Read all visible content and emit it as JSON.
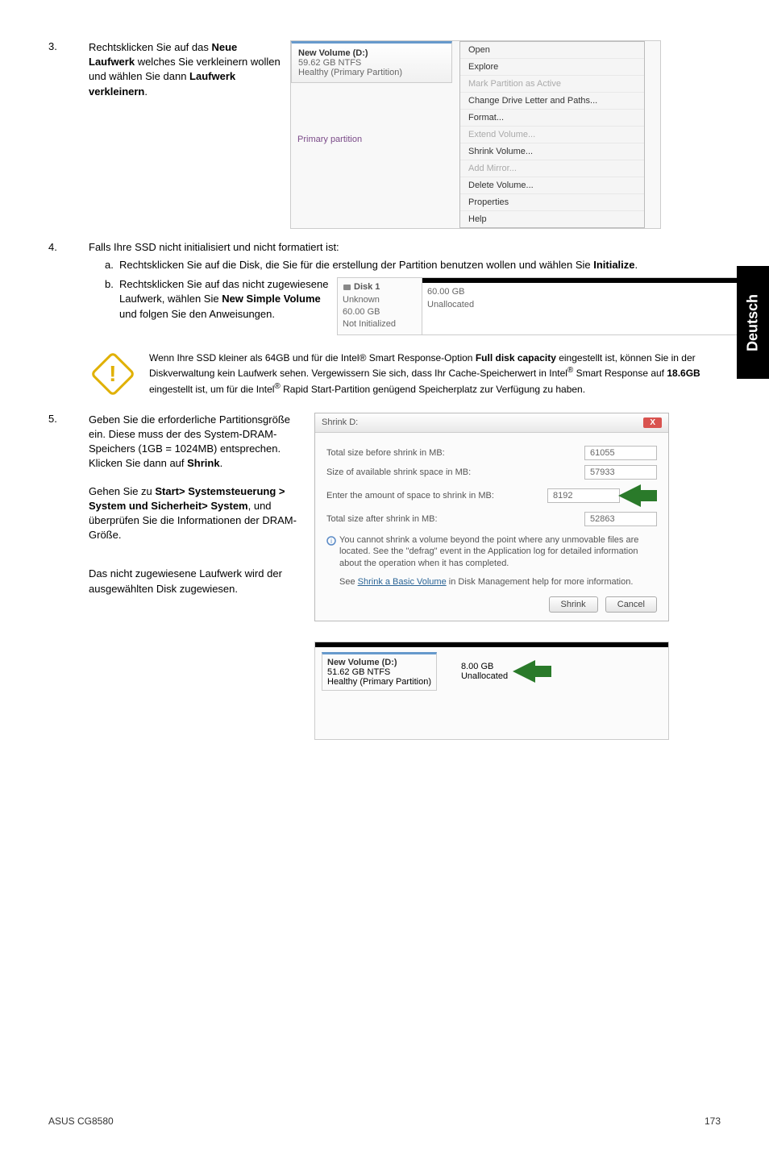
{
  "sidebar": {
    "label": "Deutsch"
  },
  "steps": {
    "s3": {
      "num": "3.",
      "text_a": "Rechtsklicken Sie auf das ",
      "text_b": "Neue Laufwerk",
      "text_c": " welches Sie verkleinern wollen und wählen Sie dann ",
      "text_d": "Laufwerk verkleinern",
      "text_e": "."
    },
    "s4": {
      "num": "4.",
      "intro": "Falls Ihre SSD nicht initialisiert und nicht formatiert ist:",
      "a_label": "a.",
      "a_text_pre": "Rechtsklicken Sie auf die Disk, die Sie für die erstellung der Partition benutzen wollen und wählen Sie ",
      "a_bold": "Initialize",
      "a_post": ".",
      "b_label": "b.",
      "b_text_pre": "Rechtsklicken Sie auf das nicht zugewiesene Laufwerk, wählen Sie ",
      "b_bold1": "New Simple Volume",
      "b_mid": " und folgen Sie den Anweisungen."
    },
    "s5": {
      "num": "5.",
      "p1_a": "Geben Sie die erforderliche Partitionsgröße ein. Diese muss der des System-DRAM-Speichers (1GB = 1024MB) entsprechen. Klicken Sie dann auf ",
      "p1_bold": "Shrink",
      "p1_b": ".",
      "p2_a": "Gehen Sie zu ",
      "p2_b": "Start> Systemsteuerung > System und Sicherheit> System",
      "p2_c": ", und überprüfen Sie die Informationen der DRAM-Größe.",
      "p3": "Das nicht zugewiesene Laufwerk wird der ausgewählten Disk zugewiesen."
    }
  },
  "ctx": {
    "vol_line1": "New Volume  (D:)",
    "vol_line2": "59.62 GB NTFS",
    "vol_line3": "Healthy (Primary Partition)",
    "primary": "Primary partition",
    "items": {
      "open": "Open",
      "explore": "Explore",
      "mark": "Mark Partition as Active",
      "change": "Change Drive Letter and Paths...",
      "format": "Format...",
      "extend": "Extend Volume...",
      "shrink": "Shrink Volume...",
      "mirror": "Add Mirror...",
      "delete": "Delete Volume...",
      "props": "Properties",
      "help": "Help"
    }
  },
  "disk1": {
    "title": "Disk 1",
    "unknown": "Unknown",
    "size": "60.00 GB",
    "state": "Not Initialized",
    "r_size": "60.00 GB",
    "r_state": "Unallocated"
  },
  "alert": {
    "text_a": "Wenn Ihre SSD kleiner als 64GB und für die Intel® Smart Response-Option ",
    "bold1": "Full disk capacity",
    "text_b": " eingestellt ist, können Sie in der Diskverwaltung kein Laufwerk sehen. Vergewissern Sie sich, dass Ihr Cache-Speicherwert in Intel",
    "reg1": "®",
    "text_c": " Smart Response auf ",
    "bold2": "18.6GB",
    "text_d": " eingestellt ist, um für die Intel",
    "reg2": "®",
    "text_e": " Rapid Start-Partition genügend Speicherplatz zur Verfügung zu haben."
  },
  "shrink": {
    "title": "Shrink D:",
    "row1": "Total size before shrink in MB:",
    "val1": "61055",
    "row2": "Size of available shrink space in MB:",
    "val2": "57933",
    "row3": "Enter the amount of space to shrink in MB:",
    "val3": "8192",
    "row4": "Total size after shrink in MB:",
    "val4": "52863",
    "note1": "You cannot shrink a volume beyond the point where any unmovable files are located. See the \"defrag\" event in the Application log for detailed information about the operation when it has completed.",
    "note2_a": "See ",
    "note2_link": "Shrink a Basic Volume",
    "note2_b": " in Disk Management help for more information.",
    "btn_shrink": "Shrink",
    "btn_cancel": "Cancel"
  },
  "result": {
    "line1": "New Volume  (D:)",
    "line2": "51.62 GB NTFS",
    "line3": "Healthy (Primary Partition)",
    "r1": "8.00 GB",
    "r2": "Unallocated"
  },
  "footer": {
    "left": "ASUS CG8580",
    "right": "173"
  }
}
